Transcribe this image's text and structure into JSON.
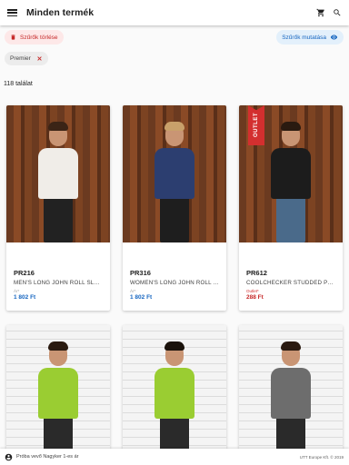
{
  "appbar": {
    "title": "Minden termék"
  },
  "filters": {
    "clear_label": "Szűrők törlése",
    "show_label": "Szűrők mutatása",
    "active_tag": "Premier"
  },
  "results": {
    "count_label": "118 találat"
  },
  "products": [
    {
      "code": "PR216",
      "name": "MEN'S LONG JOHN ROLL SLEEVE T-SHIRT",
      "price_tag": "Ár*",
      "price": "1 802 Ft",
      "outlet": false,
      "bg": "wood",
      "shirt": "#f0ede8",
      "pants": "#222222",
      "hair": "#3b2416"
    },
    {
      "code": "PR316",
      "name": "WOMEN'S LONG JOHN ROLL SLEEVE T-SHIRT",
      "price_tag": "Ár*",
      "price": "1 802 Ft",
      "outlet": false,
      "bg": "wood",
      "shirt": "#2c3e70",
      "pants": "#1e1e1e",
      "hair": "#c8a06a"
    },
    {
      "code": "PR612",
      "name": "COOLCHECKER STUDDED POLO SHIRT",
      "price_tag": "Outlet*",
      "price": "288 Ft",
      "outlet": true,
      "outlet_label": "OUTLET",
      "bg": "wood",
      "shirt": "#1c1c1c",
      "pants": "#4a6a8a",
      "hair": "#2a1a10"
    },
    {
      "code": "",
      "name": "",
      "price_tag": "",
      "price": "",
      "outlet": false,
      "bg": "brick",
      "shirt": "#9acd32",
      "pants": "#2a2a2a",
      "hair": "#2a1a10"
    },
    {
      "code": "",
      "name": "",
      "price_tag": "",
      "price": "",
      "outlet": false,
      "bg": "brick",
      "shirt": "#9acd32",
      "pants": "#2a2a2a",
      "hair": "#1a120c"
    },
    {
      "code": "",
      "name": "",
      "price_tag": "",
      "price": "",
      "outlet": false,
      "bg": "brick",
      "shirt": "#6d6d6d",
      "pants": "#2a2a2a",
      "hair": "#2a1a10"
    }
  ],
  "footer": {
    "user_label": "Próba vevő Nagyker 1-es ár",
    "copyright": "UTT Europe Kft. © 2019"
  },
  "colors": {
    "accent_blue": "#1565c0",
    "danger_red": "#c62828"
  }
}
